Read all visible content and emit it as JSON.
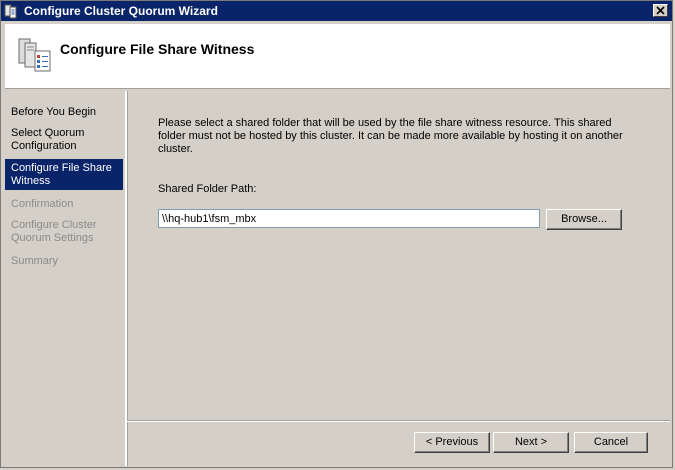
{
  "window": {
    "title": "Configure Cluster Quorum Wizard",
    "close_symbol": "×"
  },
  "header": {
    "title": "Configure File Share Witness",
    "icon": "cluster-servers-icon"
  },
  "sidebar": {
    "items": [
      {
        "label": "Before You Begin",
        "state": "normal"
      },
      {
        "label": "Select Quorum Configuration",
        "state": "normal"
      },
      {
        "label": "Configure File Share Witness",
        "state": "active"
      },
      {
        "label": "Confirmation",
        "state": "disabled"
      },
      {
        "label": "Configure Cluster Quorum Settings",
        "state": "disabled"
      },
      {
        "label": "Summary",
        "state": "disabled"
      }
    ]
  },
  "main": {
    "description": "Please select a shared folder that will be used by the file share witness resource.  This shared folder must not be hosted by this cluster.  It can be made more available by hosting it on another cluster.",
    "field_label": "Shared Folder Path:",
    "path_value": "\\\\hq-hub1\\fsm_mbx",
    "browse_label": "Browse..."
  },
  "footer": {
    "previous_label": "< Previous",
    "next_label": "Next >",
    "cancel_label": "Cancel"
  },
  "colors": {
    "titlebar": "#0a246a",
    "selected": "#0a246a",
    "dialog_bg": "#d4d0c8"
  }
}
